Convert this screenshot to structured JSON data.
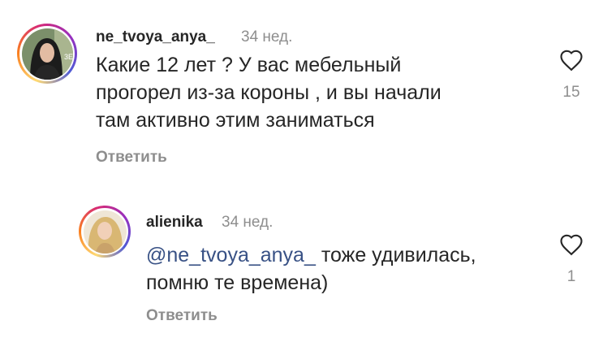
{
  "comments": [
    {
      "username": "ne_tvoya_anya_",
      "time": "34 нед.",
      "text": "Какие 12 лет ? У вас мебельный\nпрогорел из-за короны , и вы начали\nтам активно этим заниматься",
      "reply_label": "Ответить",
      "likes": "15"
    },
    {
      "username": "alienika",
      "time": "34 нед.",
      "mention": "@ne_tvoya_anya_",
      "text": " тоже удивилась,\nпомню те времена)",
      "reply_label": "Ответить",
      "likes": "1"
    }
  ],
  "colors": {
    "text": "#262626",
    "secondary": "#8e8e8e",
    "mention": "#385185"
  },
  "icons": [
    "heart-icon"
  ]
}
